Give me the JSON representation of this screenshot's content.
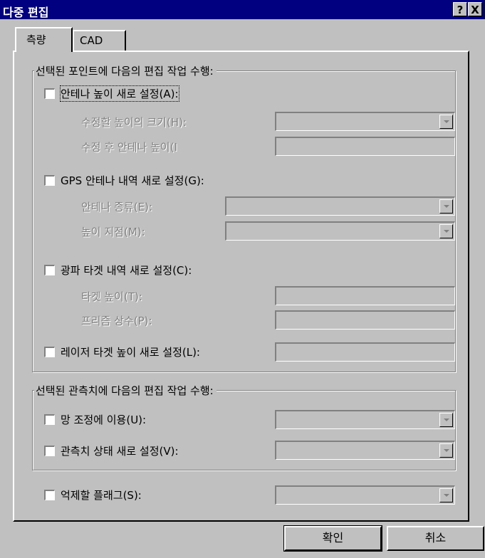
{
  "window": {
    "title": "다중 편집",
    "help_label": "?",
    "close_label": "X"
  },
  "tabs": [
    {
      "label": "측량",
      "selected": true
    },
    {
      "label": "CAD",
      "selected": false
    }
  ],
  "points_group": {
    "legend": "선택된 포인트에 다음의 편집 작업 수행:",
    "antenna_height": {
      "label": "안테나 높이 새로 설정(A):",
      "checked": false,
      "size_label": "수정할 높이의 크기(H):",
      "after_label": "수정 후 안테나 높이(I"
    },
    "gps_antenna": {
      "label": "GPS 안테나 내역 새로 설정(G):",
      "checked": false,
      "type_label": "안테나 종류(E):",
      "height_point_label": "높이 지점(M):"
    },
    "optical_target": {
      "label": "광파 타겟 내역 새로 설정(C):",
      "checked": false,
      "target_height_label": "타겟 높이(T):",
      "prism_const_label": "프리즘 상수(P):"
    },
    "laser_target": {
      "label": "레이저 타겟 높이 새로 설정(L):",
      "checked": false
    }
  },
  "obs_group": {
    "legend": "선택된 관측치에 다음의 편집 작업 수행:",
    "network_use": {
      "label": "망 조정에 이용(U):",
      "checked": false
    },
    "obs_status": {
      "label": "관측치 상태 새로 설정(V):",
      "checked": false
    }
  },
  "suppress_flag": {
    "label": "억제할 플래그(S):",
    "checked": false
  },
  "buttons": {
    "ok_label": "확인",
    "cancel_label": "취소"
  },
  "colors": {
    "titlebar": "#000080",
    "face": "#c0c0c0",
    "disabled_text": "#808080"
  }
}
